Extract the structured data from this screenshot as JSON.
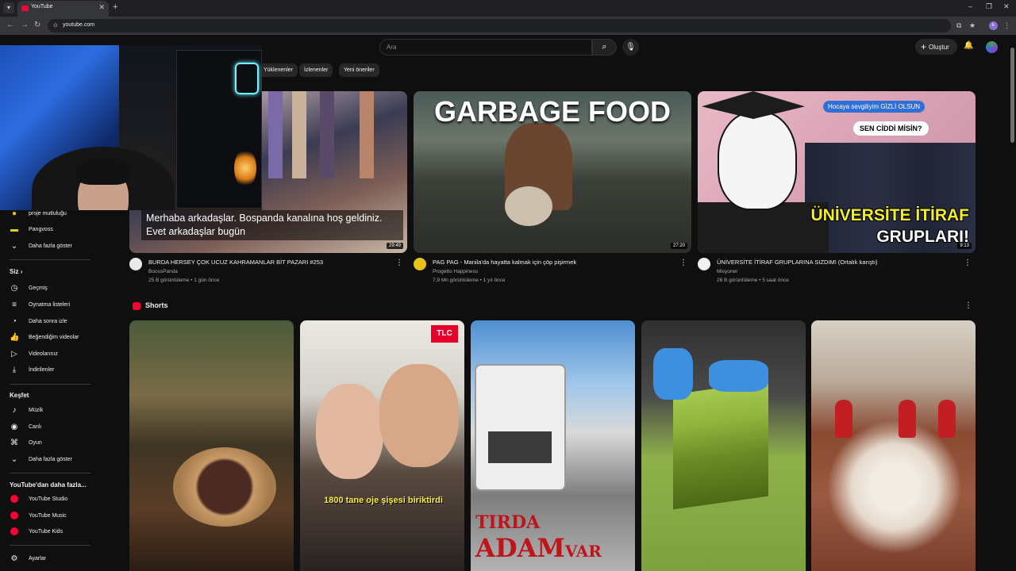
{
  "browser": {
    "tab_title": "YouTube",
    "url": "youtube.com",
    "new_tab_symbol": "+",
    "profile_initial": "k"
  },
  "masthead": {
    "search_placeholder": "Ara",
    "create_label": "Oluştur"
  },
  "chips": [
    "Yüklenenler",
    "İzlenenler",
    "Yeni öneriler"
  ],
  "sidebar": {
    "sub_items": [
      {
        "label": "proje mutluluğu"
      },
      {
        "label": "Pangvoss"
      },
      {
        "label": "Daha fazla göster",
        "icon": "chevron-down-icon"
      }
    ],
    "you_heading": "Siz",
    "you_items": [
      {
        "label": "Geçmiş",
        "icon": "history-icon"
      },
      {
        "label": "Oynatma listeleri",
        "icon": "playlist-icon"
      },
      {
        "label": "Daha sonra izle",
        "icon": "clock-icon"
      },
      {
        "label": "Beğendiğim videolar",
        "icon": "thumbs-up-icon"
      },
      {
        "label": "Videolarınız",
        "icon": "video-icon"
      },
      {
        "label": "İndirilenler",
        "icon": "download-icon"
      }
    ],
    "explore_heading": "Keşfet",
    "explore_items": [
      {
        "label": "Müzik",
        "icon": "music-icon"
      },
      {
        "label": "Canlı",
        "icon": "live-icon"
      },
      {
        "label": "Oyun",
        "icon": "gamepad-icon"
      },
      {
        "label": "Daha fazla göster",
        "icon": "chevron-down-icon"
      }
    ],
    "more_heading": "YouTube'dan daha fazla...",
    "more_items": [
      {
        "label": "YouTube Studio"
      },
      {
        "label": "YouTube Music"
      },
      {
        "label": "YouTube Kids"
      }
    ],
    "settings_label": "Ayarlar"
  },
  "videos": [
    {
      "title": "BURDA HERSEY ÇOK UCUZ KAHRAMANLAR BİT PAZARI #253",
      "channel": "BoossPanda",
      "meta": "25 B görüntüleme • 1 gün önce",
      "duration": "29:49",
      "caption": "Merhaba arkadaşlar. Bospanda kanalına hoş geldiniz. Evet arkadaşlar bugün"
    },
    {
      "title": "PAG PAG - Manila'da hayatta kalmak için çöp pişirmek",
      "channel": "Progetto Happiness",
      "meta": "7,9 Mn görüntüleme • 1 yıl önce",
      "duration": "27:20",
      "thumb_text": "GARBAGE FOOD"
    },
    {
      "title": "ÜNİVERSİTE İTİRAF GRUPLARINA SIZDIM! (Ortalık karıştı)",
      "channel": "Misyoner",
      "meta": "26 B görüntüleme • 5 saat önce",
      "duration": "9:13",
      "bubble1": "Hocaya sevgiliyim GİZLİ OLSUN",
      "bubble2": "SEN CİDDİ MİSİN?",
      "big1": "ÜNİVERSİTE İTİRAF",
      "big2": "GRUPLARI!"
    }
  ],
  "shorts": {
    "heading": "Shorts",
    "s2_caption": "1800 tane oje şişesi biriktirdi",
    "s2_logo": "TLC",
    "s3_line1": "TIRDA",
    "s3_line2": "ADAM",
    "s3_line2_small": "VAR"
  }
}
